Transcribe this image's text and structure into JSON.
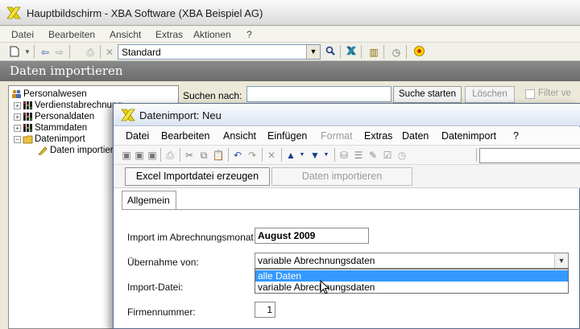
{
  "main_window": {
    "title": "Hauptbildschirm - XBA Software (XBA Beispiel AG)",
    "menu": [
      "Datei",
      "Bearbeiten",
      "Ansicht",
      "Extras",
      "Aktionen",
      "?"
    ],
    "toolbar_combo_value": "Standard",
    "section_title": "Daten importieren",
    "tree": [
      {
        "label": "Personalwesen",
        "icon": "people-icon"
      },
      {
        "label": "Verdienstabrechnung",
        "icon": "traffic-light-icon"
      },
      {
        "label": "Personaldaten",
        "icon": "traffic-light-icon"
      },
      {
        "label": "Stammdaten",
        "icon": "traffic-light-icon"
      },
      {
        "label": "Datenimport",
        "icon": "folder-icon"
      },
      {
        "label": "Daten importieren",
        "icon": "pen-icon"
      }
    ],
    "search": {
      "label": "Suchen nach:",
      "value": "",
      "start_button": "Suche starten",
      "clear_button": "Löschen",
      "filter_label": "Filter ve"
    }
  },
  "dialog": {
    "title": "Datenimport: Neu",
    "menu": [
      "Datei",
      "Bearbeiten",
      "Ansicht",
      "Einfügen",
      "Format",
      "Extras",
      "Daten",
      "Datenimport",
      "?"
    ],
    "menu_disabled": [
      "Format"
    ],
    "actions": {
      "excel_button": "Excel Importdatei erzeugen",
      "import_button": "Daten importieren"
    },
    "tabs": [
      "Allgemein"
    ],
    "fields": {
      "month_label": "Import im Abrechnungsmonat",
      "month_value": "August 2009",
      "source_label": "Übernahme von:",
      "source_value": "variable Abrechnungsdaten",
      "source_options": [
        "alle Daten",
        "variable Abrechnungsdaten"
      ],
      "source_selected_index": 0,
      "file_label": "Import-Datei:",
      "firm_label": "Firmennummer:",
      "firm_value": "1"
    }
  },
  "colors": {
    "accent_selection": "#3399ff",
    "section_header": "#7a7a7a",
    "app_icon": "#d9c400"
  }
}
